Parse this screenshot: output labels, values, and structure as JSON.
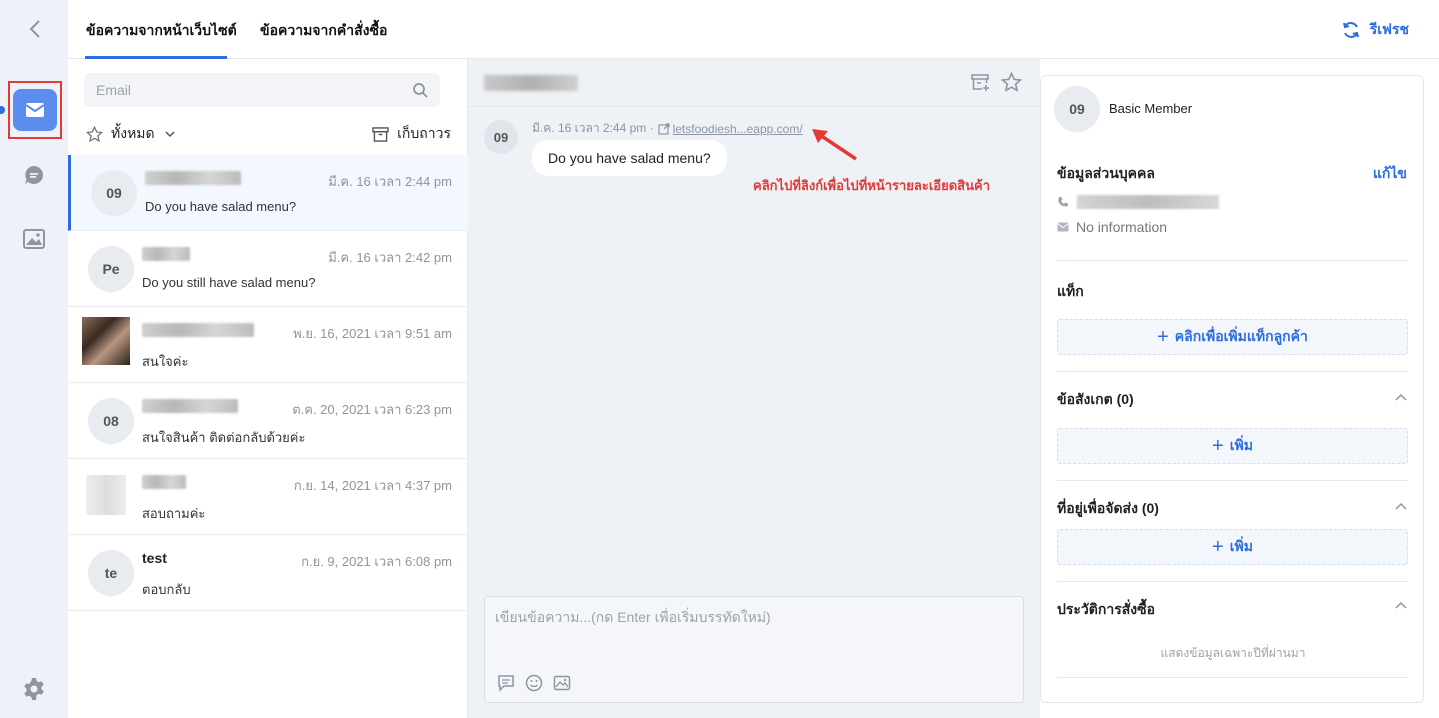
{
  "header": {
    "tabs": [
      {
        "label": "ข้อความจากหน้าเว็บไซต์"
      },
      {
        "label": "ข้อความจากคำสั่งซื้อ"
      }
    ],
    "refresh_label": "รีเฟรช"
  },
  "colors": {
    "accent": "#2d6cdf",
    "annotation": "#e53935",
    "rail_bg": "#eef2f8"
  },
  "rail": {
    "icons": [
      "chevron-left-icon",
      "mail-icon",
      "chat-icon",
      "image-icon",
      "gear-icon"
    ]
  },
  "list": {
    "search_placeholder": "Email",
    "filter_label": "ทั้งหมด",
    "archive_label": "เก็บถาวร",
    "conversations": [
      {
        "avatar": "09",
        "time": "มี.ค. 16 เวลา 2:44 pm",
        "message": "Do you have salad menu?"
      },
      {
        "avatar": "Pe",
        "time": "มี.ค. 16 เวลา 2:42 pm",
        "message": "Do you still have salad menu?"
      },
      {
        "avatar": "",
        "time": "พ.ย. 16, 2021 เวลา 9:51 am",
        "message": "สนใจค่ะ"
      },
      {
        "avatar": "08",
        "time": "ต.ค. 20, 2021 เวลา 6:23 pm",
        "message": "สนใจสินค้า ติดต่อกลับด้วยค่ะ"
      },
      {
        "avatar": "",
        "time": "ก.ย. 14, 2021 เวลา 4:37 pm",
        "message": "สอบถามค่ะ"
      },
      {
        "avatar": "te",
        "name": "test",
        "time": "ก.ย. 9, 2021 เวลา 6:08 pm",
        "message": "ตอบกลับ"
      }
    ]
  },
  "chat": {
    "message": {
      "avatar": "09",
      "time": "มี.ค. 16 เวลา 2:44 pm ·",
      "link_text": "letsfoodiesh...eapp.com/",
      "text": "Do you have salad menu?"
    },
    "annotation": "คลิกไปที่ลิงก์เพื่อไปที่หน้ารายละเอียดสินค้า",
    "composer_placeholder": "เขียนข้อความ...(กด Enter เพื่อเริ่มบรรทัดใหม่)"
  },
  "info": {
    "avatar": "09",
    "member_level": "Basic Member",
    "personal_title": "ข้อมูลส่วนบุคคล",
    "edit_label": "แก้ไข",
    "email_value": "No information",
    "tags_title": "แท็ก",
    "add_tag_label": "คลิกเพื่อเพิ่มแท็กลูกค้า",
    "notes_title": "ข้อสังเกต (0)",
    "add_label": "เพิ่ม",
    "address_title": "ที่อยู่เพื่อจัดส่ง (0)",
    "history_title": "ประวัติการสั่งซื้อ",
    "history_note": "แสดงข้อมูลเฉพาะปีที่ผ่านมา"
  }
}
